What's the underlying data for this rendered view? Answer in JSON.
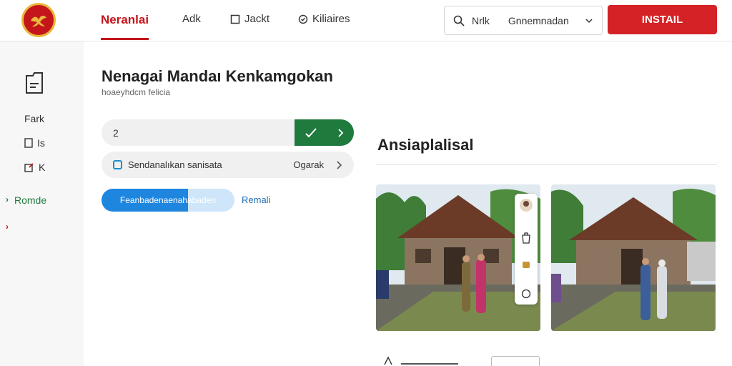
{
  "header": {
    "tabs": [
      {
        "label": "Neranlai",
        "active": true
      },
      {
        "label": "Adk",
        "active": false
      },
      {
        "label": "Jackt",
        "active": false
      },
      {
        "label": "Kiliaires",
        "active": false
      }
    ],
    "search": {
      "label": "Nrlk",
      "selected": "Gnnemnadan"
    },
    "install_label": "INSTAIL"
  },
  "sidebar": {
    "items": [
      {
        "label": "Fark"
      },
      {
        "label": "Is"
      },
      {
        "label": "K"
      },
      {
        "label": "Romde"
      }
    ]
  },
  "main": {
    "title": "Nenagai Mandaı Kenkamgokan",
    "subtitle": "hoaeyhdcm felicia",
    "input_value": "2",
    "option": {
      "label": "Sendanalıkan sanisata",
      "value": "Ogarak"
    },
    "progress": {
      "label": "Feanbadenaenahabaden",
      "fraction": 0.65
    },
    "link_label": "Remali"
  },
  "gallery": {
    "title": "Ansiaplalisal"
  },
  "colors": {
    "brand_red": "#d42226",
    "accent_green": "#1f7a3e",
    "progress_blue": "#1f86e0"
  },
  "icons": [
    "logo",
    "document-icon",
    "search-icon",
    "chevron-down-icon",
    "check-icon",
    "chevron-right-icon",
    "box-icon",
    "badge-icon",
    "edit-icon",
    "trash-icon",
    "bag-icon"
  ]
}
